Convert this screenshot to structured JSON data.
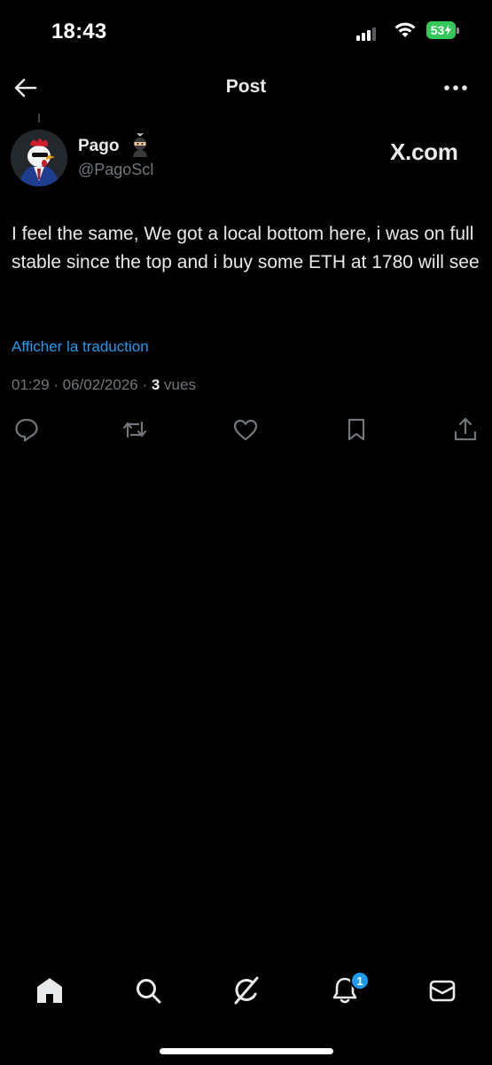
{
  "status_bar": {
    "time": "18:43",
    "battery_level": "53",
    "battery_color": "#34c759"
  },
  "header": {
    "title": "Post"
  },
  "post": {
    "author_name": "Pago",
    "author_handle": "@PagoScl",
    "source": "X.com",
    "text": "I feel the same, We got a local bottom here, i was on full stable since the top and i buy some ETH at 1780 will see",
    "translate_label": "Afficher la traduction",
    "timestamp": "01:29 · 06/02/2026 · ",
    "views_count": "3",
    "views_label": " vues"
  },
  "actions": [
    "reply-icon",
    "repost-icon",
    "like-icon",
    "bookmark-icon",
    "share-icon"
  ],
  "bottom_nav": {
    "items": [
      "home-icon",
      "search-icon",
      "grok-icon",
      "notifications-icon",
      "messages-icon"
    ],
    "notification_count": "1"
  },
  "colors": {
    "background": "#000000",
    "text_primary": "#e7e9ea",
    "text_secondary": "#71767b",
    "accent": "#1d9bf0"
  }
}
